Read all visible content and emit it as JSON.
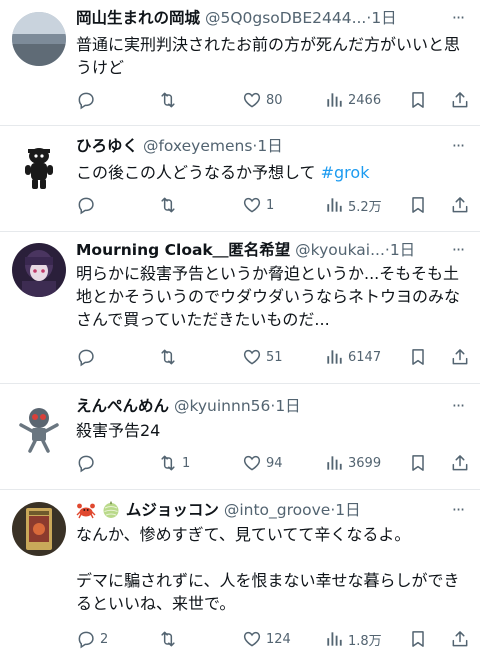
{
  "posts": [
    {
      "name": "岡山生まれの岡城",
      "handle": "@5Q0gsoDBE2444...",
      "dot": "·",
      "time": "1日",
      "text": "普通に実刑判決されたお前の方が死んだ方がいいと思うけど",
      "replies": "",
      "retweets": "",
      "likes": "80",
      "views": "2466"
    },
    {
      "name": "ひろゆく",
      "handle": "@foxeyemens",
      "dot": "·",
      "time": "1日",
      "text": "この後この人どうなるか予想して ",
      "hashtag": "#grok",
      "replies": "",
      "retweets": "",
      "likes": "1",
      "views": "5.2万"
    },
    {
      "name": "Mourning Cloak＿匿名希望",
      "handle": "@kyoukai...",
      "dot": "·",
      "time": "1日",
      "text": "明らかに殺害予告というか脅迫というか...そもそも土地とかそういうのでウダウダいうならネトウヨのみなさんで買っていただきたいものだ...",
      "replies": "",
      "retweets": "",
      "likes": "51",
      "views": "6147"
    },
    {
      "name": "えんぺんめん",
      "handle": "@kyuinnn56",
      "dot": "·",
      "time": "1日",
      "text": "殺害予告24",
      "replies": "",
      "retweets": "1",
      "likes": "94",
      "views": "3699"
    },
    {
      "name": "ムジョッコン",
      "handle": "@into_groove",
      "dot": "·",
      "time": "1日",
      "text": "なんか、惨めすぎて、見ていてて辛くなるよ。\n\nデマに騙されずに、人を恨まない幸せな暮らしができるといいね、来世で。",
      "replies": "2",
      "retweets": "",
      "likes": "124",
      "views": "1.8万"
    }
  ],
  "more_label": "···",
  "colors": {
    "text": "#0f1419",
    "secondary": "#536471",
    "link": "#1d9bf0",
    "divider": "#e6e9ec"
  },
  "icons": [
    "reply-icon",
    "retweet-icon",
    "like-icon",
    "views-icon",
    "bookmark-icon",
    "share-icon",
    "more-icon"
  ]
}
